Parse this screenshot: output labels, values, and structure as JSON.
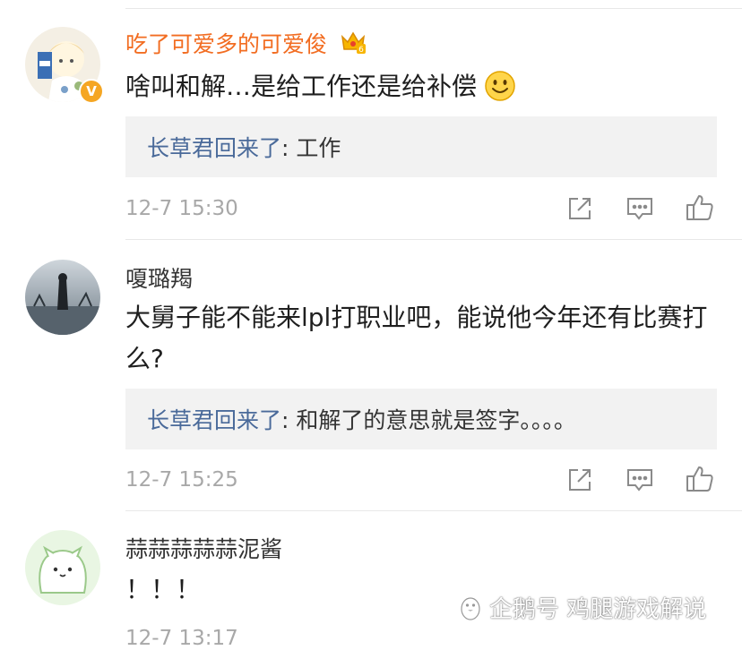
{
  "comments": [
    {
      "username": "吃了可爱多的可爱俊",
      "text": "啥叫和解…是给工作还是给补偿",
      "reply_user": "长草君回来了",
      "reply_sep": ": ",
      "reply_text": "工作",
      "time": "12-7 15:30",
      "verified_badge": "V",
      "crown_icon": "crown-vip-icon",
      "emoji_icon": "smile-emoji-icon"
    },
    {
      "username": "嗄璐羯",
      "text": "大舅子能不能来lpl打职业吧，能说他今年还有比赛打么?",
      "reply_user": "长草君回来了",
      "reply_sep": ": ",
      "reply_text": "和解了的意思就是签字。。。。",
      "time": "12-7 15:25"
    },
    {
      "username": "蒜蒜蒜蒜蒜泥酱",
      "text": "！！！",
      "time": "12-7 13:17"
    }
  ],
  "watermark": {
    "text": "企鹅号 鸡腿游戏解说",
    "icon": "penguin-logo-icon"
  },
  "colors": {
    "vip_name": "#f26d22",
    "reply_user": "#4a6a9a",
    "badge": "#f5a623",
    "time": "#a8a8a8"
  }
}
